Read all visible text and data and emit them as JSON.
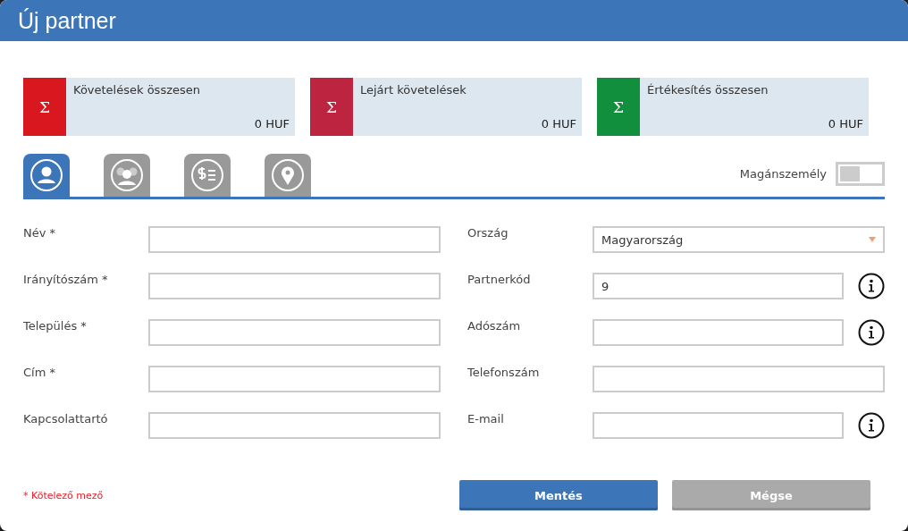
{
  "window": {
    "title": "Új partner"
  },
  "summary_cards": [
    {
      "label": "Követelések összesen",
      "value": "0 HUF",
      "symbol": "Σ",
      "color": "#d9171e"
    },
    {
      "label": "Lejárt követelések",
      "value": "0 HUF",
      "symbol": "Σ",
      "color": "#bd2440"
    },
    {
      "label": "Értékesítés összesen",
      "value": "0 HUF",
      "symbol": "Σ",
      "color": "#118f3d"
    }
  ],
  "tabs": [
    {
      "kind": "person",
      "selected": true
    },
    {
      "kind": "group",
      "selected": false
    },
    {
      "kind": "finance",
      "selected": false
    },
    {
      "kind": "location",
      "selected": false
    }
  ],
  "private_person_toggle": {
    "label": "Magánszemély",
    "on": false
  },
  "left_fields": [
    {
      "label": "Név *"
    },
    {
      "label": "Irányítószám *"
    },
    {
      "label": "Település *"
    },
    {
      "label": "Cím *"
    },
    {
      "label": "Kapcsolattartó"
    }
  ],
  "right_fields": [
    {
      "label": "Ország",
      "kind": "select",
      "value": "Magyarország",
      "info": false
    },
    {
      "label": "Partnerkód",
      "kind": "text",
      "value": "9",
      "info": true
    },
    {
      "label": "Adószám",
      "kind": "text",
      "info": true
    },
    {
      "label": "Telefonszám",
      "kind": "text",
      "info": false
    },
    {
      "label": "E-mail",
      "kind": "text",
      "info": true
    }
  ],
  "required_note": "* Kötelező mező",
  "buttons": [
    {
      "label": "Mentés",
      "kind": "primary"
    },
    {
      "label": "Mégse",
      "kind": "secondary"
    }
  ]
}
